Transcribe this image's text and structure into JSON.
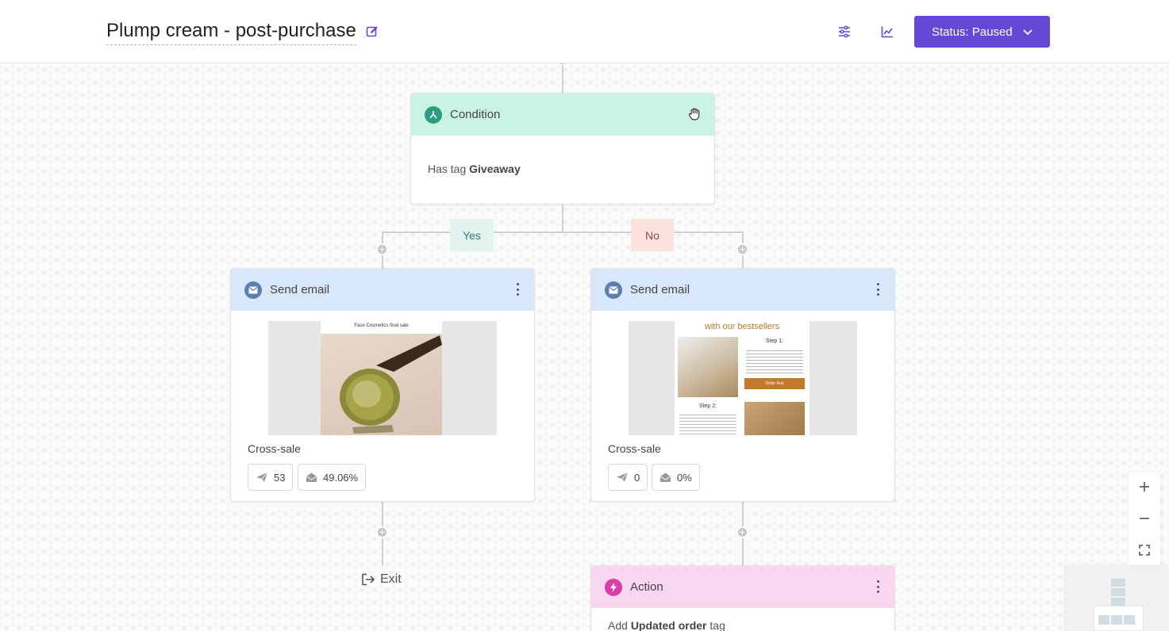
{
  "header": {
    "title": "Plump cream - post-purchase",
    "status_label": "Status: Paused",
    "icons": [
      "pencil-edit-icon",
      "sliders-icon",
      "line-chart-icon",
      "chevron-down-icon"
    ],
    "accent_color": "#6648d6"
  },
  "condition": {
    "title": "Condition",
    "body_prefix": "Has tag",
    "body_tag": "Giveaway",
    "header_color": "#c9f4e4"
  },
  "branches": {
    "yes": {
      "label": "Yes",
      "color": "#e3f3ef",
      "text_color": "#2e7d6e"
    },
    "no": {
      "label": "No",
      "color": "#fbe3dc",
      "text_color": "#8a4b3c"
    }
  },
  "emails": [
    {
      "title": "Send email",
      "preview_heading": "Face Cosmetics final sale",
      "name": "Cross-sale",
      "sent": "53",
      "open_rate": "49.06%"
    },
    {
      "title": "Send email",
      "preview_heading": "with our bestsellers",
      "preview_step1": "Step 1:",
      "preview_step2": "Step 2:",
      "preview_button": "Order Rub",
      "name": "Cross-sale",
      "sent": "0",
      "open_rate": "0%"
    }
  ],
  "exit": {
    "label": "Exit"
  },
  "action": {
    "title": "Action",
    "body_prefix": "Add",
    "body_tag": "Updated order",
    "body_suffix": "tag",
    "header_color": "#f8d6ef"
  },
  "zoom": {
    "icons": [
      "zoom-in-icon",
      "zoom-out-icon",
      "fit-screen-icon"
    ]
  }
}
